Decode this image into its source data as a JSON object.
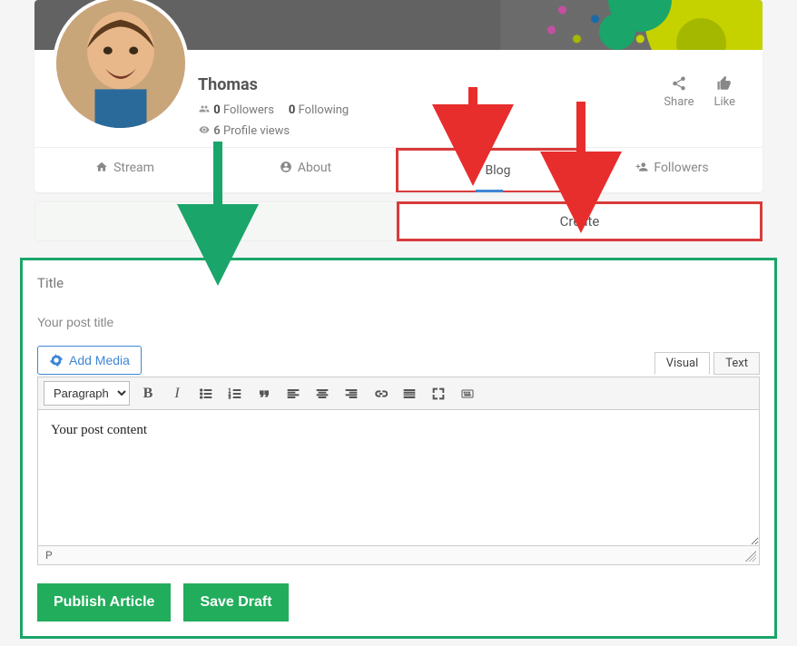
{
  "profile": {
    "name": "Thomas",
    "followers_count": "0",
    "followers_label": "Followers",
    "following_count": "0",
    "following_label": "Following",
    "views_count": "6",
    "views_label": "Profile views"
  },
  "social": {
    "share_label": "Share",
    "like_label": "Like"
  },
  "tabs": {
    "stream": "Stream",
    "about": "About",
    "blog": "Blog",
    "followers": "Followers"
  },
  "create": {
    "label": "Create"
  },
  "editor": {
    "title_label": "Title",
    "title_placeholder": "Your post title",
    "add_media_label": "Add Media",
    "visual_tab": "Visual",
    "text_tab": "Text",
    "format_dropdown": "Paragraph",
    "content_placeholder": "Your post content",
    "path_indicator": "P",
    "publish_label": "Publish Article",
    "draft_label": "Save Draft"
  }
}
